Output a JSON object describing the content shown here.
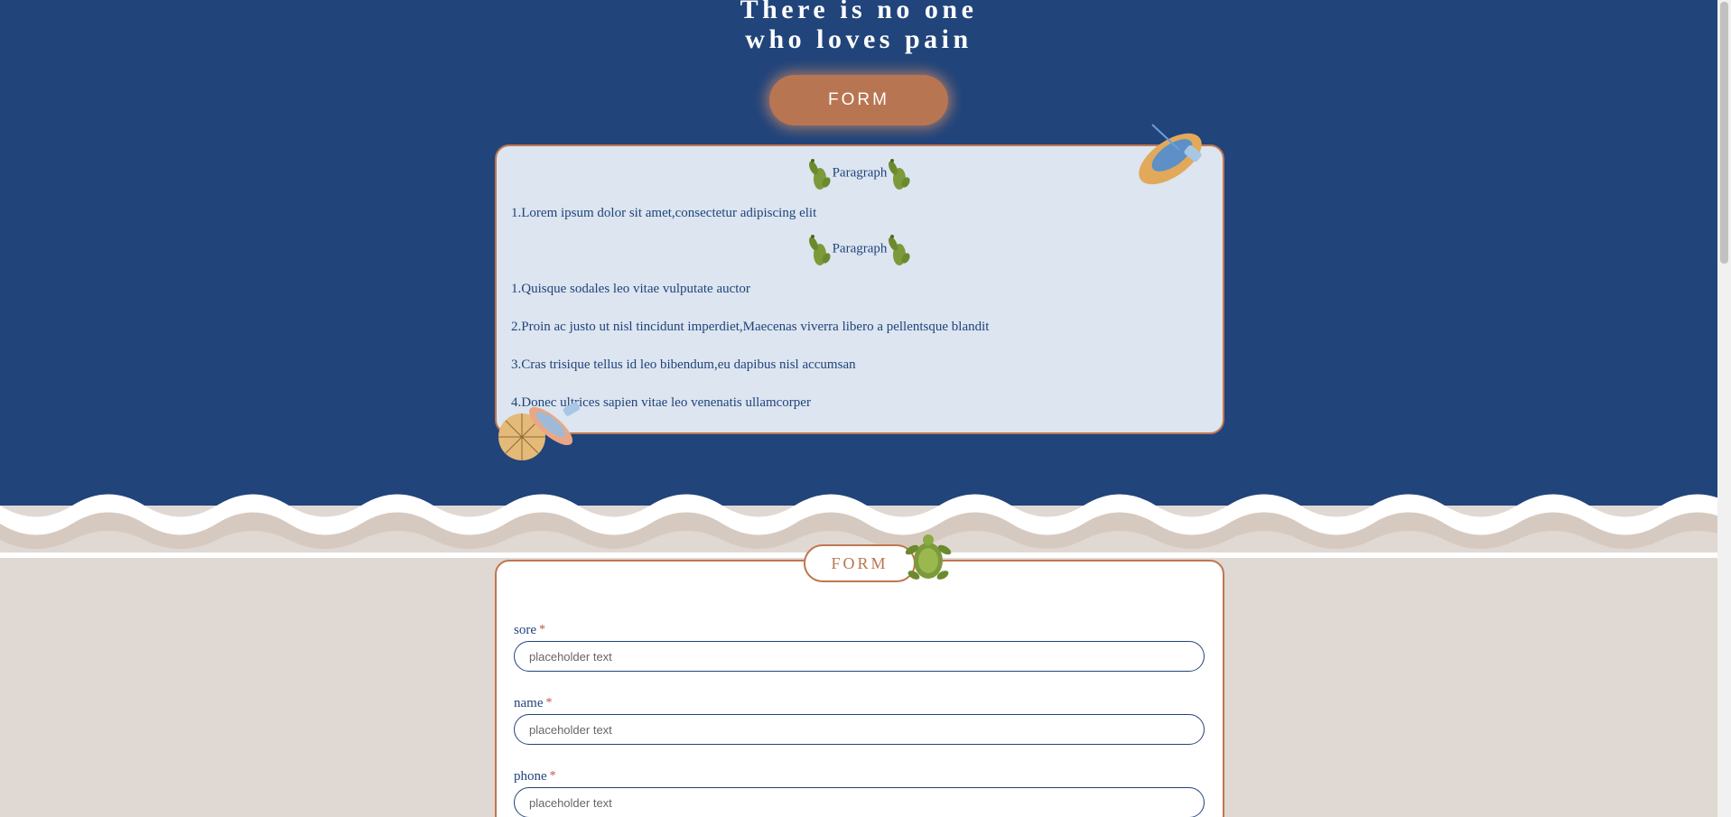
{
  "hero": {
    "title_line1": "There is no one",
    "title_line2": "who loves pain",
    "form_button_label": "FORM"
  },
  "info_card": {
    "heading1": "Paragraph",
    "item1": "1.Lorem ipsum dolor sit amet,consectetur adipiscing elit",
    "heading2": "Paragraph",
    "list2": [
      "1.Quisque sodales leo vitae vulputate auctor",
      "2.Proin ac justo ut nisl tincidunt imperdiet,Maecenas viverra libero a pellentsque blandit",
      "3.Cras trisique tellus id leo bibendum,eu dapibus nisl accumsan",
      "4.Donec ultrices sapien vitae leo venenatis ullamcorper"
    ]
  },
  "form": {
    "tab_label": "FORM",
    "fields": [
      {
        "label": "sore",
        "required_mark": "*",
        "placeholder": "placeholder text"
      },
      {
        "label": "name",
        "required_mark": "*",
        "placeholder": "placeholder text"
      },
      {
        "label": "phone",
        "required_mark": "*",
        "placeholder": "placeholder text"
      }
    ]
  },
  "colors": {
    "navy": "#21447b",
    "terracotta": "#b87552",
    "card_bg": "#dce5f0",
    "sand": "#e0d8d2",
    "cactus": "#7c9a3a"
  },
  "icons": [
    "cactus-icon",
    "rowboat-icon",
    "parasol-boat-icon",
    "turtle-icon"
  ]
}
